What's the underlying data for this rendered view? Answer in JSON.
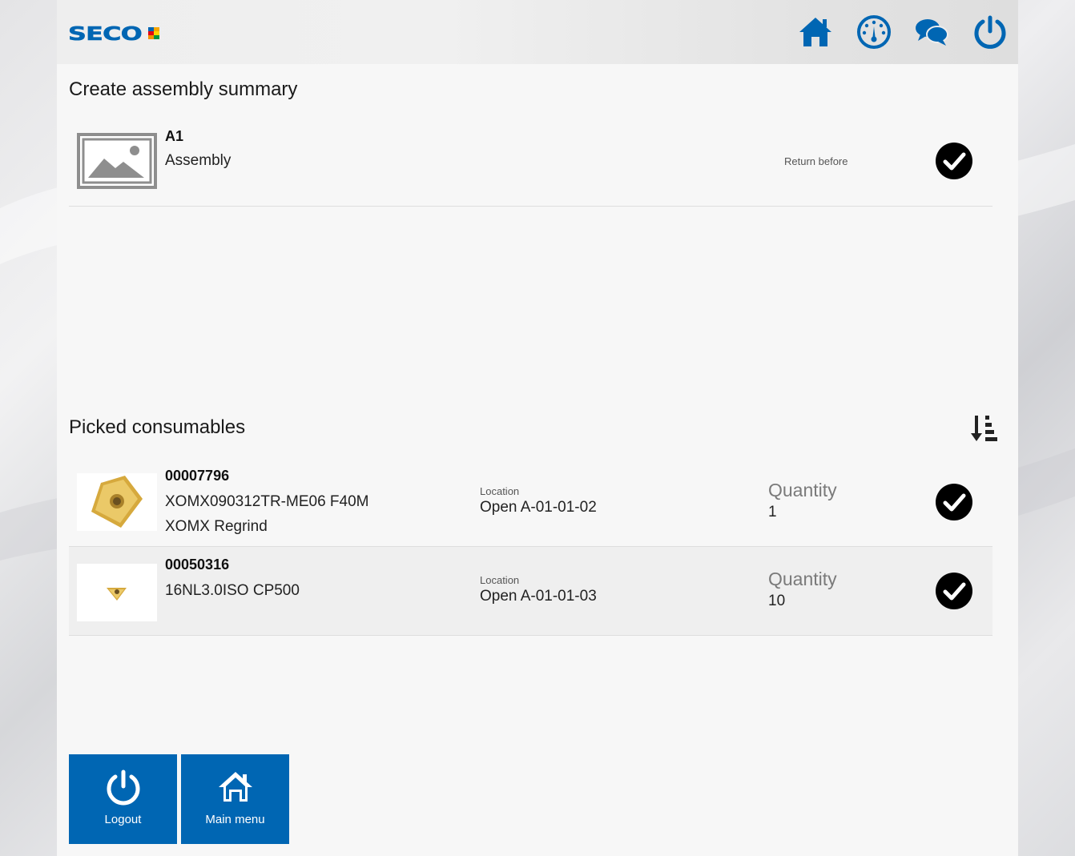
{
  "header": {
    "logo_text": "SECO",
    "nav": [
      "home-icon",
      "dashboard-gauge-icon",
      "chat-bubbles-icon",
      "power-icon"
    ],
    "brand_color": "#0066b3"
  },
  "assembly_section": {
    "title": "Create assembly summary",
    "item": {
      "code": "A1",
      "type": "Assembly",
      "return_label": "Return before"
    }
  },
  "consumables_section": {
    "title": "Picked consumables",
    "items": [
      {
        "code": "00007796",
        "name": "XOMX090312TR-ME06 F40M",
        "subname": "XOMX Regrind",
        "location_label": "Location",
        "location": "Open A-01-01-02",
        "quantity_label": "Quantity",
        "quantity": "1"
      },
      {
        "code": "00050316",
        "name": "16NL3.0ISO CP500",
        "location_label": "Location",
        "location": "Open A-01-01-03",
        "quantity_label": "Quantity",
        "quantity": "10"
      }
    ]
  },
  "footer": {
    "logout_label": "Logout",
    "main_menu_label": "Main menu"
  }
}
